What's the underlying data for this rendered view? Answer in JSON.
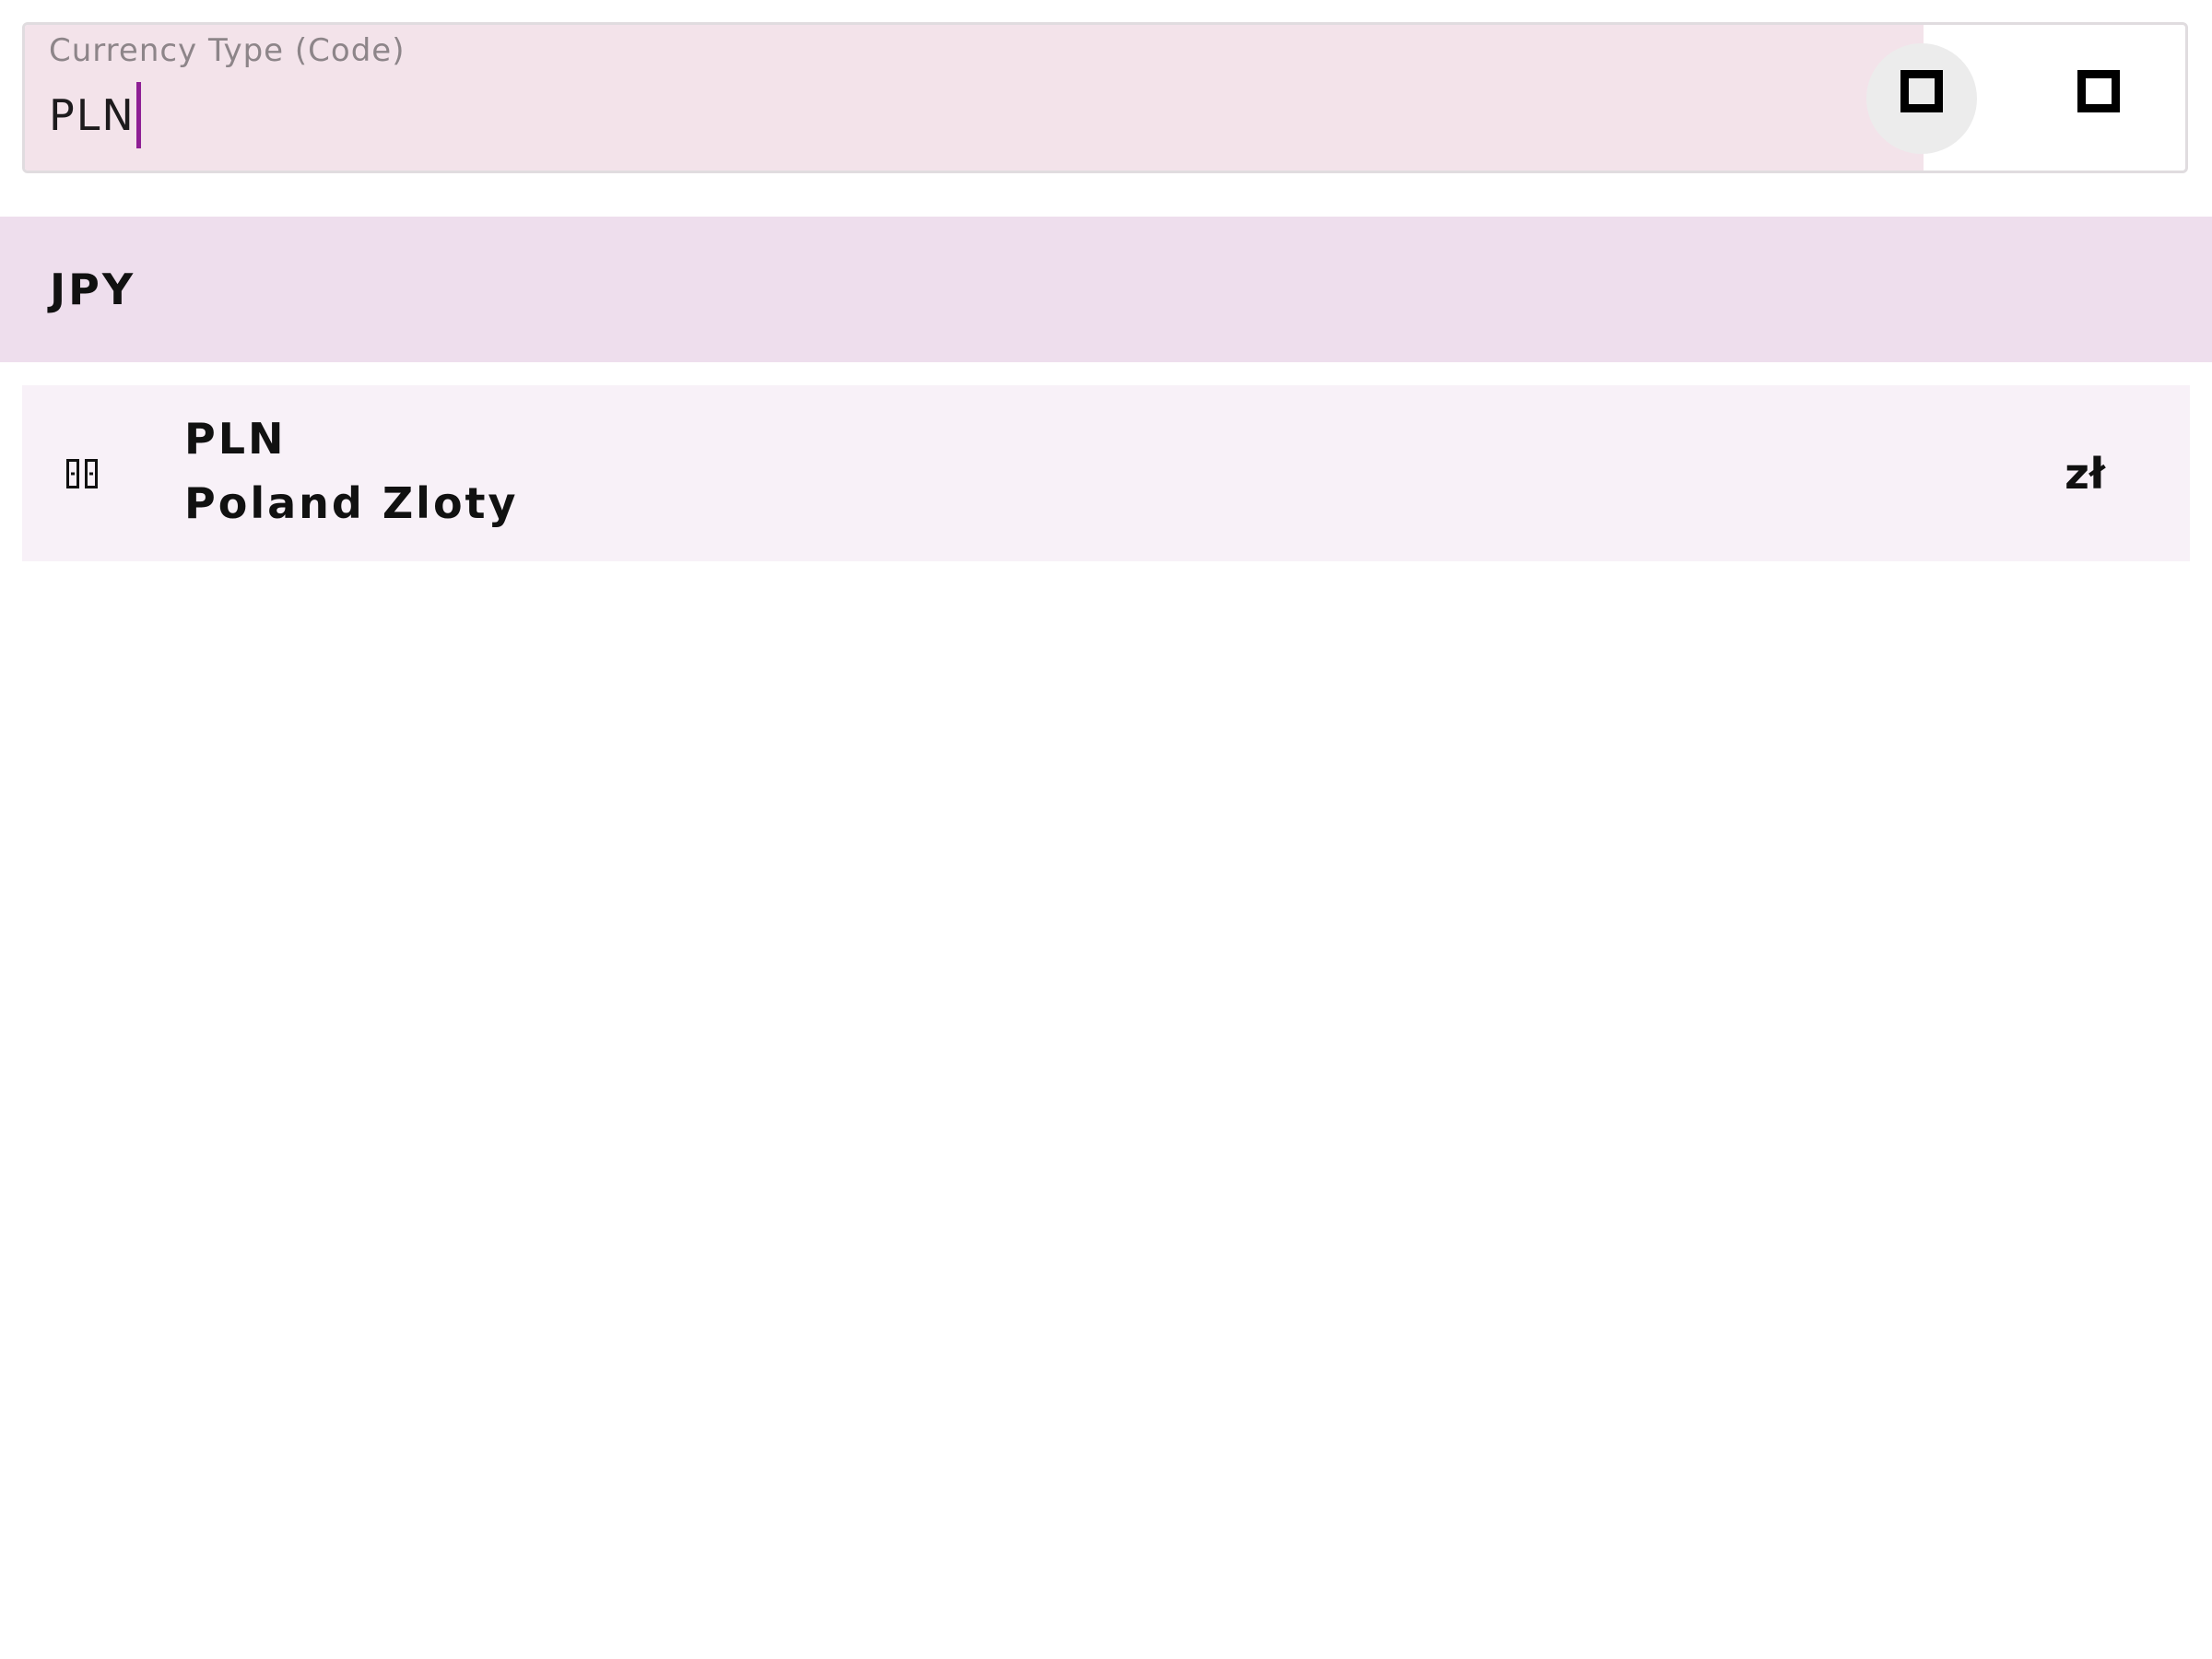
{
  "search": {
    "label": "Currency Type (Code)",
    "value": "PLN",
    "buttons": [
      {
        "icon": "square-icon"
      },
      {
        "icon": "square-icon"
      }
    ]
  },
  "header": {
    "code": "JPY"
  },
  "results": [
    {
      "flag_icon": "poland-flag-icon",
      "code": "PLN",
      "name": "Poland Zloty",
      "symbol": "zł"
    }
  ],
  "colors": {
    "field_fill": "#f3e3ea",
    "header_fill": "#eedeed",
    "row_fill": "#f8f1f8",
    "caret": "#8e1f94"
  }
}
